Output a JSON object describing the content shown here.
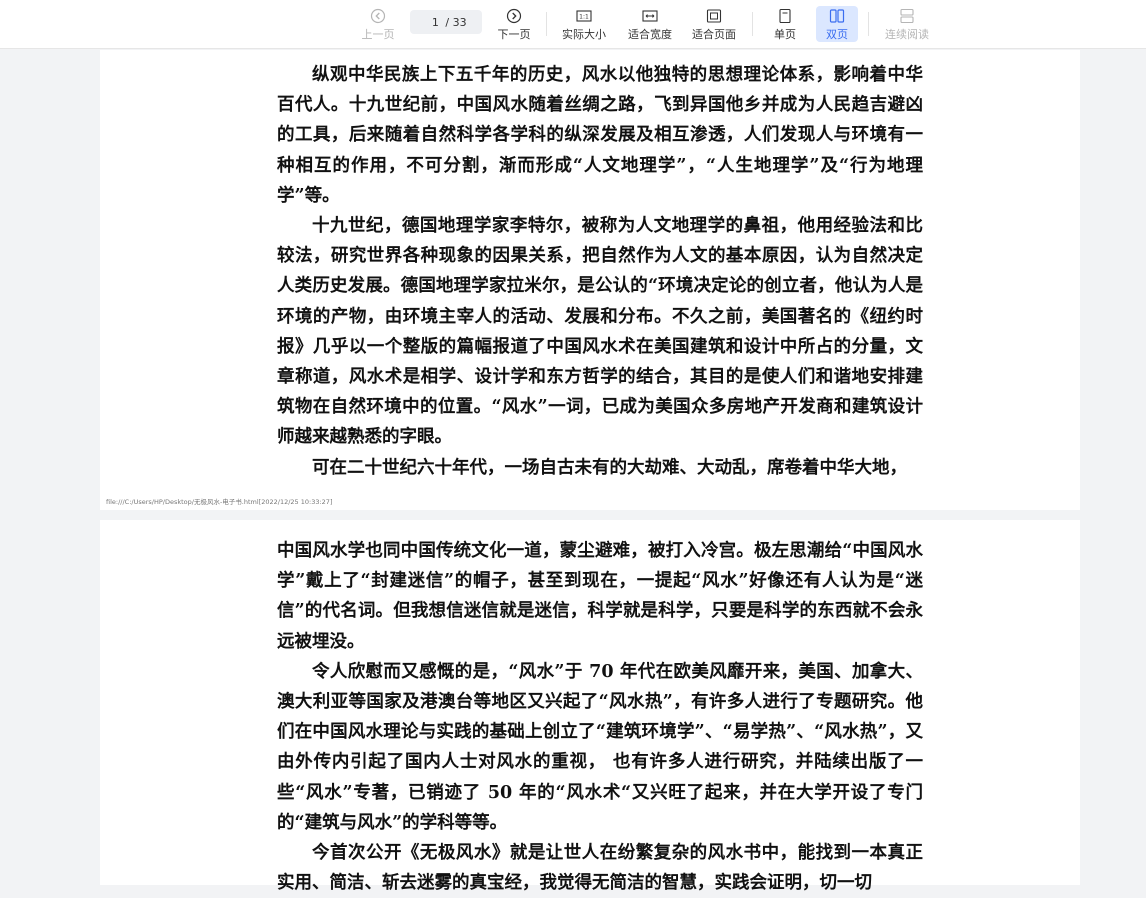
{
  "toolbar": {
    "prev_page": "上一页",
    "next_page": "下一页",
    "page_current": "1",
    "page_total": "/ 33",
    "actual_size": "实际大小",
    "actual_size_icon_text": "1:1",
    "fit_width": "适合宽度",
    "fit_page": "适合页面",
    "single_page": "单页",
    "double_page": "双页",
    "continuous_reading": "连续阅读"
  },
  "page1": {
    "paragraphs": [
      "纵观中华民族上下五千年的历史，风水以他独特的思想理论体系，影响着中华百代人。十九世纪前，中国风水随着丝绸之路，飞到异国他乡并成为人民趋吉避凶的工具，后来随着自然科学各学科的纵深发展及相互渗透，人们发现人与环境有一种相互的作用，不可分割，渐而形成“人文地理学”，“人生地理学”及“行为地理学”等。",
      "十九世纪，德国地理学家李特尔，被称为人文地理学的鼻祖，他用经验法和比较法，研究世界各种现象的因果关系，把自然作为人文的基本原因，认为自然决定人类历史发展。德国地理学家拉米尔，是公认的“环境决定论的创立者，他认为人是环境的产物，由环境主宰人的活动、发展和分布。不久之前，美国著名的《纽约时报》几乎以一个整版的篇幅报道了中国风水术在美国建筑和设计中所占的分量，文章称道，风水术是相学、设计学和东方哲学的结合，其目的是使人们和谐地安排建筑物在自然环境中的位置。“风水”一词，已成为美国众多房地产开发商和建筑设计师越来越熟悉的字眼。",
      "可在二十世纪六十年代，一场自古未有的大劫难、大动乱，席卷着中华大地，"
    ],
    "footer": "file:///C:/Users/HP/Desktop/无极风水-电子书.html[2022/12/25 10:33:27]"
  },
  "page2": {
    "paragraphs": [
      "中国风水学也同中国传统文化一道，蒙尘避难，被打入冷宫。极左思潮给“中国风水学”戴上了“封建迷信”的帽子，甚至到现在，一提起“风水”好像还有人认为是“迷信”的代名词。但我想信迷信就是迷信，科学就是科学，只要是科学的东西就不会永远被埋没。",
      "令人欣慰而又感慨的是，“风水”于 70 年代在欧美风靡开来，美国、加拿大、澳大利亚等国家及港澳台等地区又兴起了“风水热”，有许多人进行了专题研究。他们在中国风水理论与实践的基础上创立了“建筑环境学”、“易学热”、“风水热”，又由外传内引起了国内人士对风水的重视， 也有许多人进行研究，并陆续出版了一些“风水”专著，已销迹了 50 年的“风水术“又兴旺了起来，并在大学开设了专门的“建筑与风水”的学科等等。",
      "今首次公开《无极风水》就是让世人在纷繁复杂的风水书中，能找到一本真正实用、简洁、斩去迷雾的真宝经，我觉得无简洁的智慧，实践会证明，切一切"
    ]
  },
  "colors": {
    "toolbar_bg": "#ffffff",
    "active_bg": "#dbe7ff",
    "active_text": "#3a6df0",
    "disabled_text": "#b5b5b5",
    "viewer_bg": "#f2f3f5"
  },
  "icons": {
    "prev": "circle-left-arrow-icon",
    "next": "circle-right-arrow-icon",
    "actual_size": "actual-size-icon",
    "fit_width": "fit-width-icon",
    "fit_page": "fit-page-icon",
    "single_page": "single-page-icon",
    "double_page": "double-page-icon",
    "continuous": "continuous-reading-icon"
  }
}
